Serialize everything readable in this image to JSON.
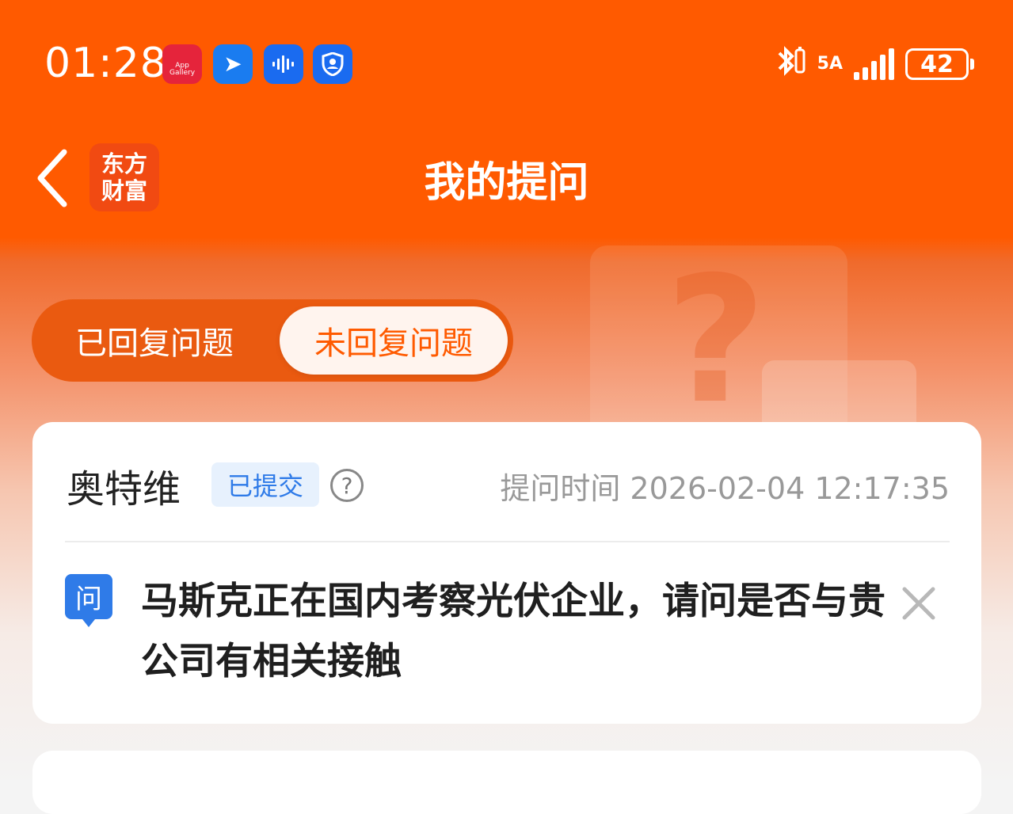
{
  "status_bar": {
    "time": "01:28",
    "app_gallery_label": "App Gallery",
    "network_label": "5A",
    "battery_level": "42"
  },
  "header": {
    "logo_line1": "东方",
    "logo_line2": "财富",
    "title": "我的提问"
  },
  "tabs": [
    {
      "label": "已回复问题",
      "selected": false
    },
    {
      "label": "未回复问题",
      "selected": true
    }
  ],
  "question_card": {
    "company": "奥特维",
    "status": "已提交",
    "help": "?",
    "ask_time": "提问时间 2026-02-04 12:17:35",
    "q_badge": "问",
    "question": "马斯克正在国内考察光伏企业，请问是否与贵公司有相关接触"
  },
  "colors": {
    "brand": "#ff5a00",
    "status_blue": "#2f7be8"
  }
}
